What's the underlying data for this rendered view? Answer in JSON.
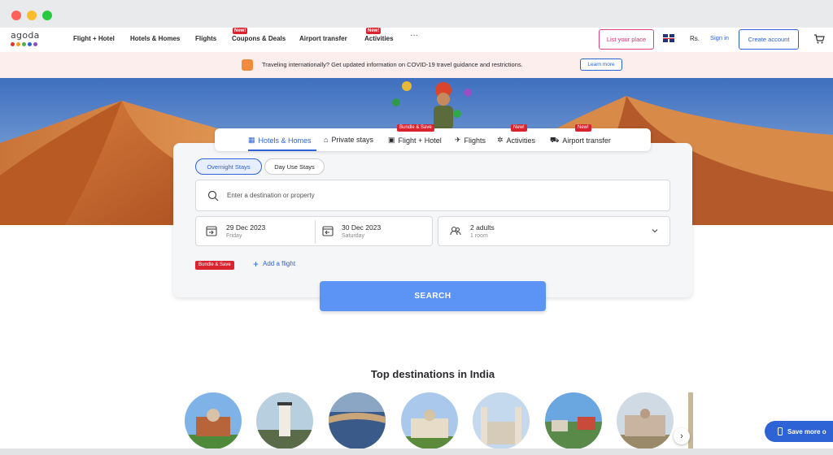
{
  "window": {
    "controls": [
      "#fe5f57",
      "#febb2e",
      "#28c840"
    ]
  },
  "header": {
    "logo_text": "agoda",
    "logo_colors": [
      "#e0352b",
      "#f59f1a",
      "#4dae4a",
      "#2e63d6",
      "#8e4fc6"
    ],
    "nav": [
      {
        "label": "Flight + Hotel",
        "badge": ""
      },
      {
        "label": "Hotels & Homes",
        "badge": ""
      },
      {
        "label": "Flights",
        "badge": ""
      },
      {
        "label": "Coupons & Deals",
        "badge": "New!"
      },
      {
        "label": "Airport transfer",
        "badge": ""
      },
      {
        "label": "Activities",
        "badge": "New!"
      }
    ],
    "more_label": "···",
    "list_place": "List your place",
    "flag_icon": "uk-flag-icon",
    "currency": "Rs.",
    "sign_in": "Sign in",
    "create_account": "Create account",
    "cart_icon": "cart-icon"
  },
  "banner": {
    "text": "Traveling internationally? Get updated information on COVID-19 travel guidance and restrictions.",
    "learn_more": "Learn more"
  },
  "search": {
    "tabs": [
      {
        "label": "Hotels & Homes",
        "icon": "building-icon",
        "badge": "",
        "active": true
      },
      {
        "label": "Private stays",
        "icon": "house-icon",
        "badge": ""
      },
      {
        "label": "Flight + Hotel",
        "icon": "bundle-icon",
        "badge": "Bundle & Save"
      },
      {
        "label": "Flights",
        "icon": "plane-icon",
        "badge": ""
      },
      {
        "label": "Activities",
        "icon": "activity-icon",
        "badge": "New!"
      },
      {
        "label": "Airport transfer",
        "icon": "car-icon",
        "badge": "New!"
      }
    ],
    "stay_types": [
      "Overnight Stays",
      "Day Use Stays"
    ],
    "destination_placeholder": "Enter a destination or property",
    "checkin": {
      "date": "29 Dec 2023",
      "day": "Friday"
    },
    "checkout": {
      "date": "30 Dec 2023",
      "day": "Saturday"
    },
    "guests": {
      "adults": "2 adults",
      "rooms": "1 room"
    },
    "bundle_badge": "Bundle & Save",
    "add_flight": "Add a flight",
    "search_button": "SEARCH"
  },
  "destinations": {
    "title": "Top destinations in India",
    "next_icon": "chevron-right-icon"
  },
  "promo": {
    "save_more": "Save more o"
  },
  "colors": {
    "accent": "#2e63d6",
    "search_btn": "#5c94f6",
    "badge_red": "#d9232e",
    "banner_bg": "#fdeeee"
  }
}
